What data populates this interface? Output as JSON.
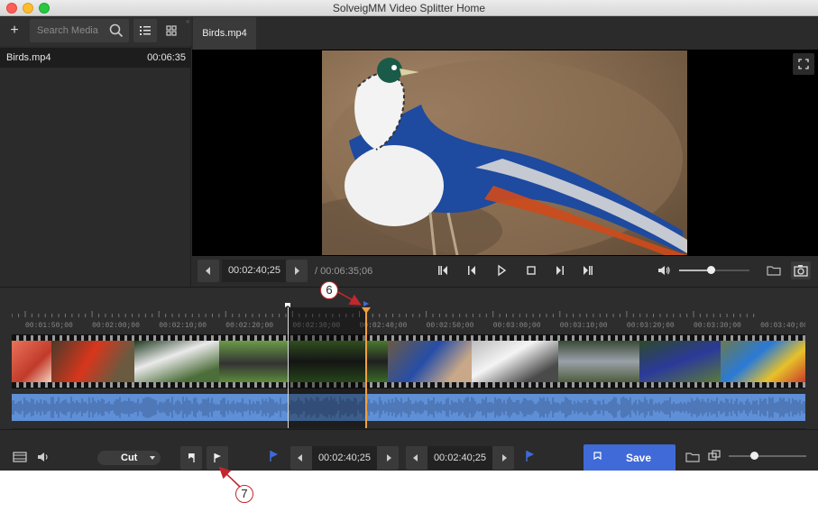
{
  "window": {
    "title": "SolveigMM Video Splitter Home"
  },
  "media_panel": {
    "add_label": "+",
    "search_placeholder": "Search Media",
    "items": [
      {
        "name": "Birds.mp4",
        "duration": "00:06:35"
      }
    ]
  },
  "tabs": [
    {
      "label": "Birds.mp4"
    }
  ],
  "transport": {
    "current_time": "00:02:40;25",
    "total_time": "/ 00:06:35;06",
    "volume_level": 0.45
  },
  "timeline": {
    "ticks": [
      "00:01:50;00",
      "00:02:00;00",
      "00:02:10;00",
      "00:02:20;00",
      "00:02:30;00",
      "00:02:40;00",
      "00:02:50;00",
      "00:03:00;00",
      "00:03:10;00",
      "00:03:20;00",
      "00:03:30;00",
      "00:03:40;00"
    ]
  },
  "bottom": {
    "mode": "Cut",
    "in_time": "00:02:40;25",
    "out_time": "00:02:40;25",
    "save_label": "Save",
    "zoom_level": 0.33
  },
  "annotations": {
    "callout_6": "6",
    "callout_7": "7",
    "accent": "#c1272d"
  },
  "colors": {
    "save": "#3f6ad8",
    "waveform": "#5f8fd6",
    "playhead": "#f0a040"
  }
}
